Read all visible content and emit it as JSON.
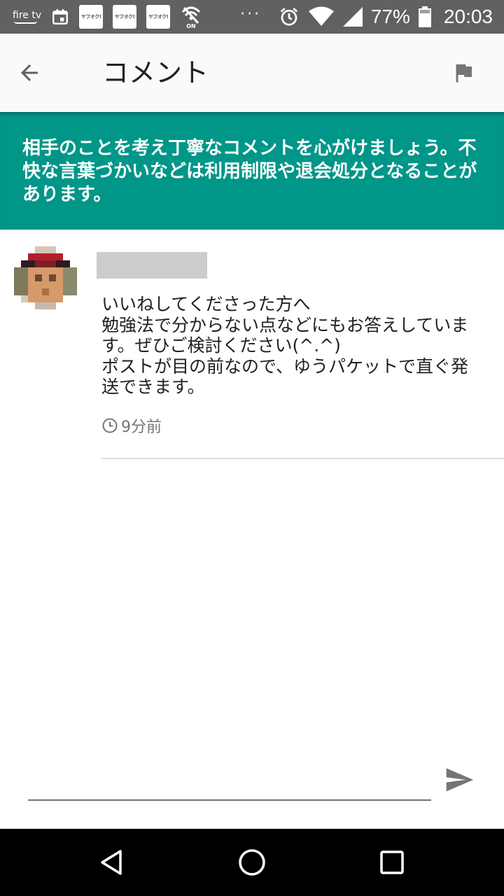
{
  "status_bar": {
    "firetv_label": "fire tv",
    "yahuoku_label": "ヤフオク!",
    "wifi_on_label": "ON",
    "overflow": "···",
    "battery_percent": "77%",
    "time": "20:03",
    "icons": [
      "firetv-icon",
      "calendar-icon",
      "yahuoku-icon",
      "yahuoku-icon",
      "yahuoku-icon",
      "wifi-on-icon",
      "alarm-icon",
      "wifi-icon",
      "signal-icon",
      "battery-icon"
    ]
  },
  "app_bar": {
    "title": "コメント"
  },
  "notice": {
    "text": "相手のことを考え丁寧なコメントを心がけましょう。不快な言葉づかいなどは利用制限や退会処分となることがあります。"
  },
  "comment": {
    "body": "いいねしてくださった方へ\n勉強法で分からない点などにもお答えしています。ぜひご検討ください(^.^)\nポストが目の前なので、ゆうパケットで直ぐ発送できます。",
    "time_ago": "9分前"
  },
  "input": {
    "value": "",
    "placeholder": ""
  },
  "colors": {
    "accent": "#009688",
    "status_bar": "#616161",
    "app_bar": "#fafafa",
    "nav_bar": "#000000",
    "meta_text": "#757575"
  }
}
